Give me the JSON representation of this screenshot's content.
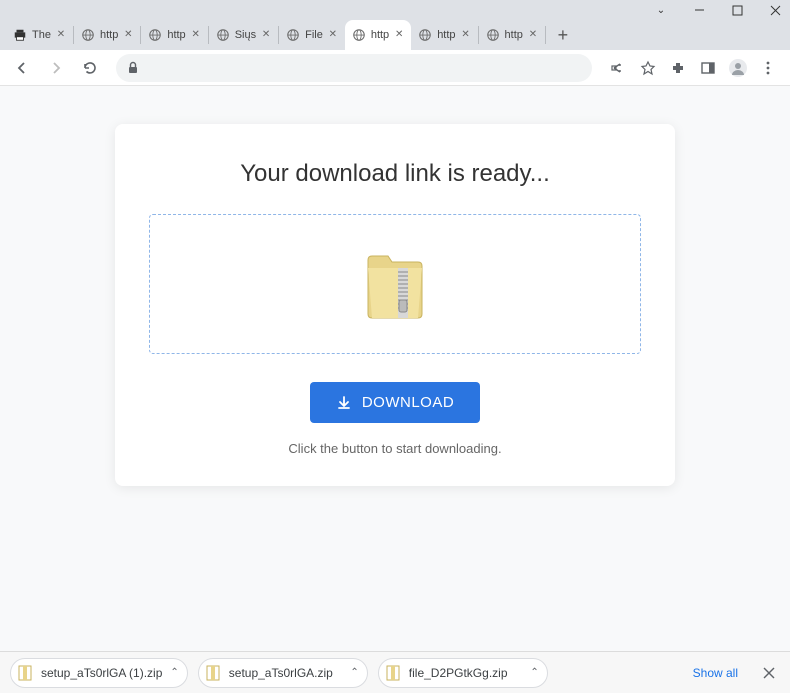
{
  "tabs": [
    {
      "label": "The",
      "type": "printer"
    },
    {
      "label": "http",
      "type": "globe"
    },
    {
      "label": "http",
      "type": "globe"
    },
    {
      "label": "Siųs",
      "type": "globe"
    },
    {
      "label": "File",
      "type": "globe"
    },
    {
      "label": "http",
      "type": "globe",
      "active": true
    },
    {
      "label": "http",
      "type": "globe"
    },
    {
      "label": "http",
      "type": "globe"
    }
  ],
  "page": {
    "heading": "Your download link is ready...",
    "button": "DOWNLOAD",
    "hint": "Click the button to start downloading."
  },
  "downloads": {
    "items": [
      {
        "name": "setup_aTs0rlGA (1).zip"
      },
      {
        "name": "setup_aTs0rlGA.zip"
      },
      {
        "name": "file_D2PGtkGg.zip"
      }
    ],
    "show_all": "Show all"
  }
}
